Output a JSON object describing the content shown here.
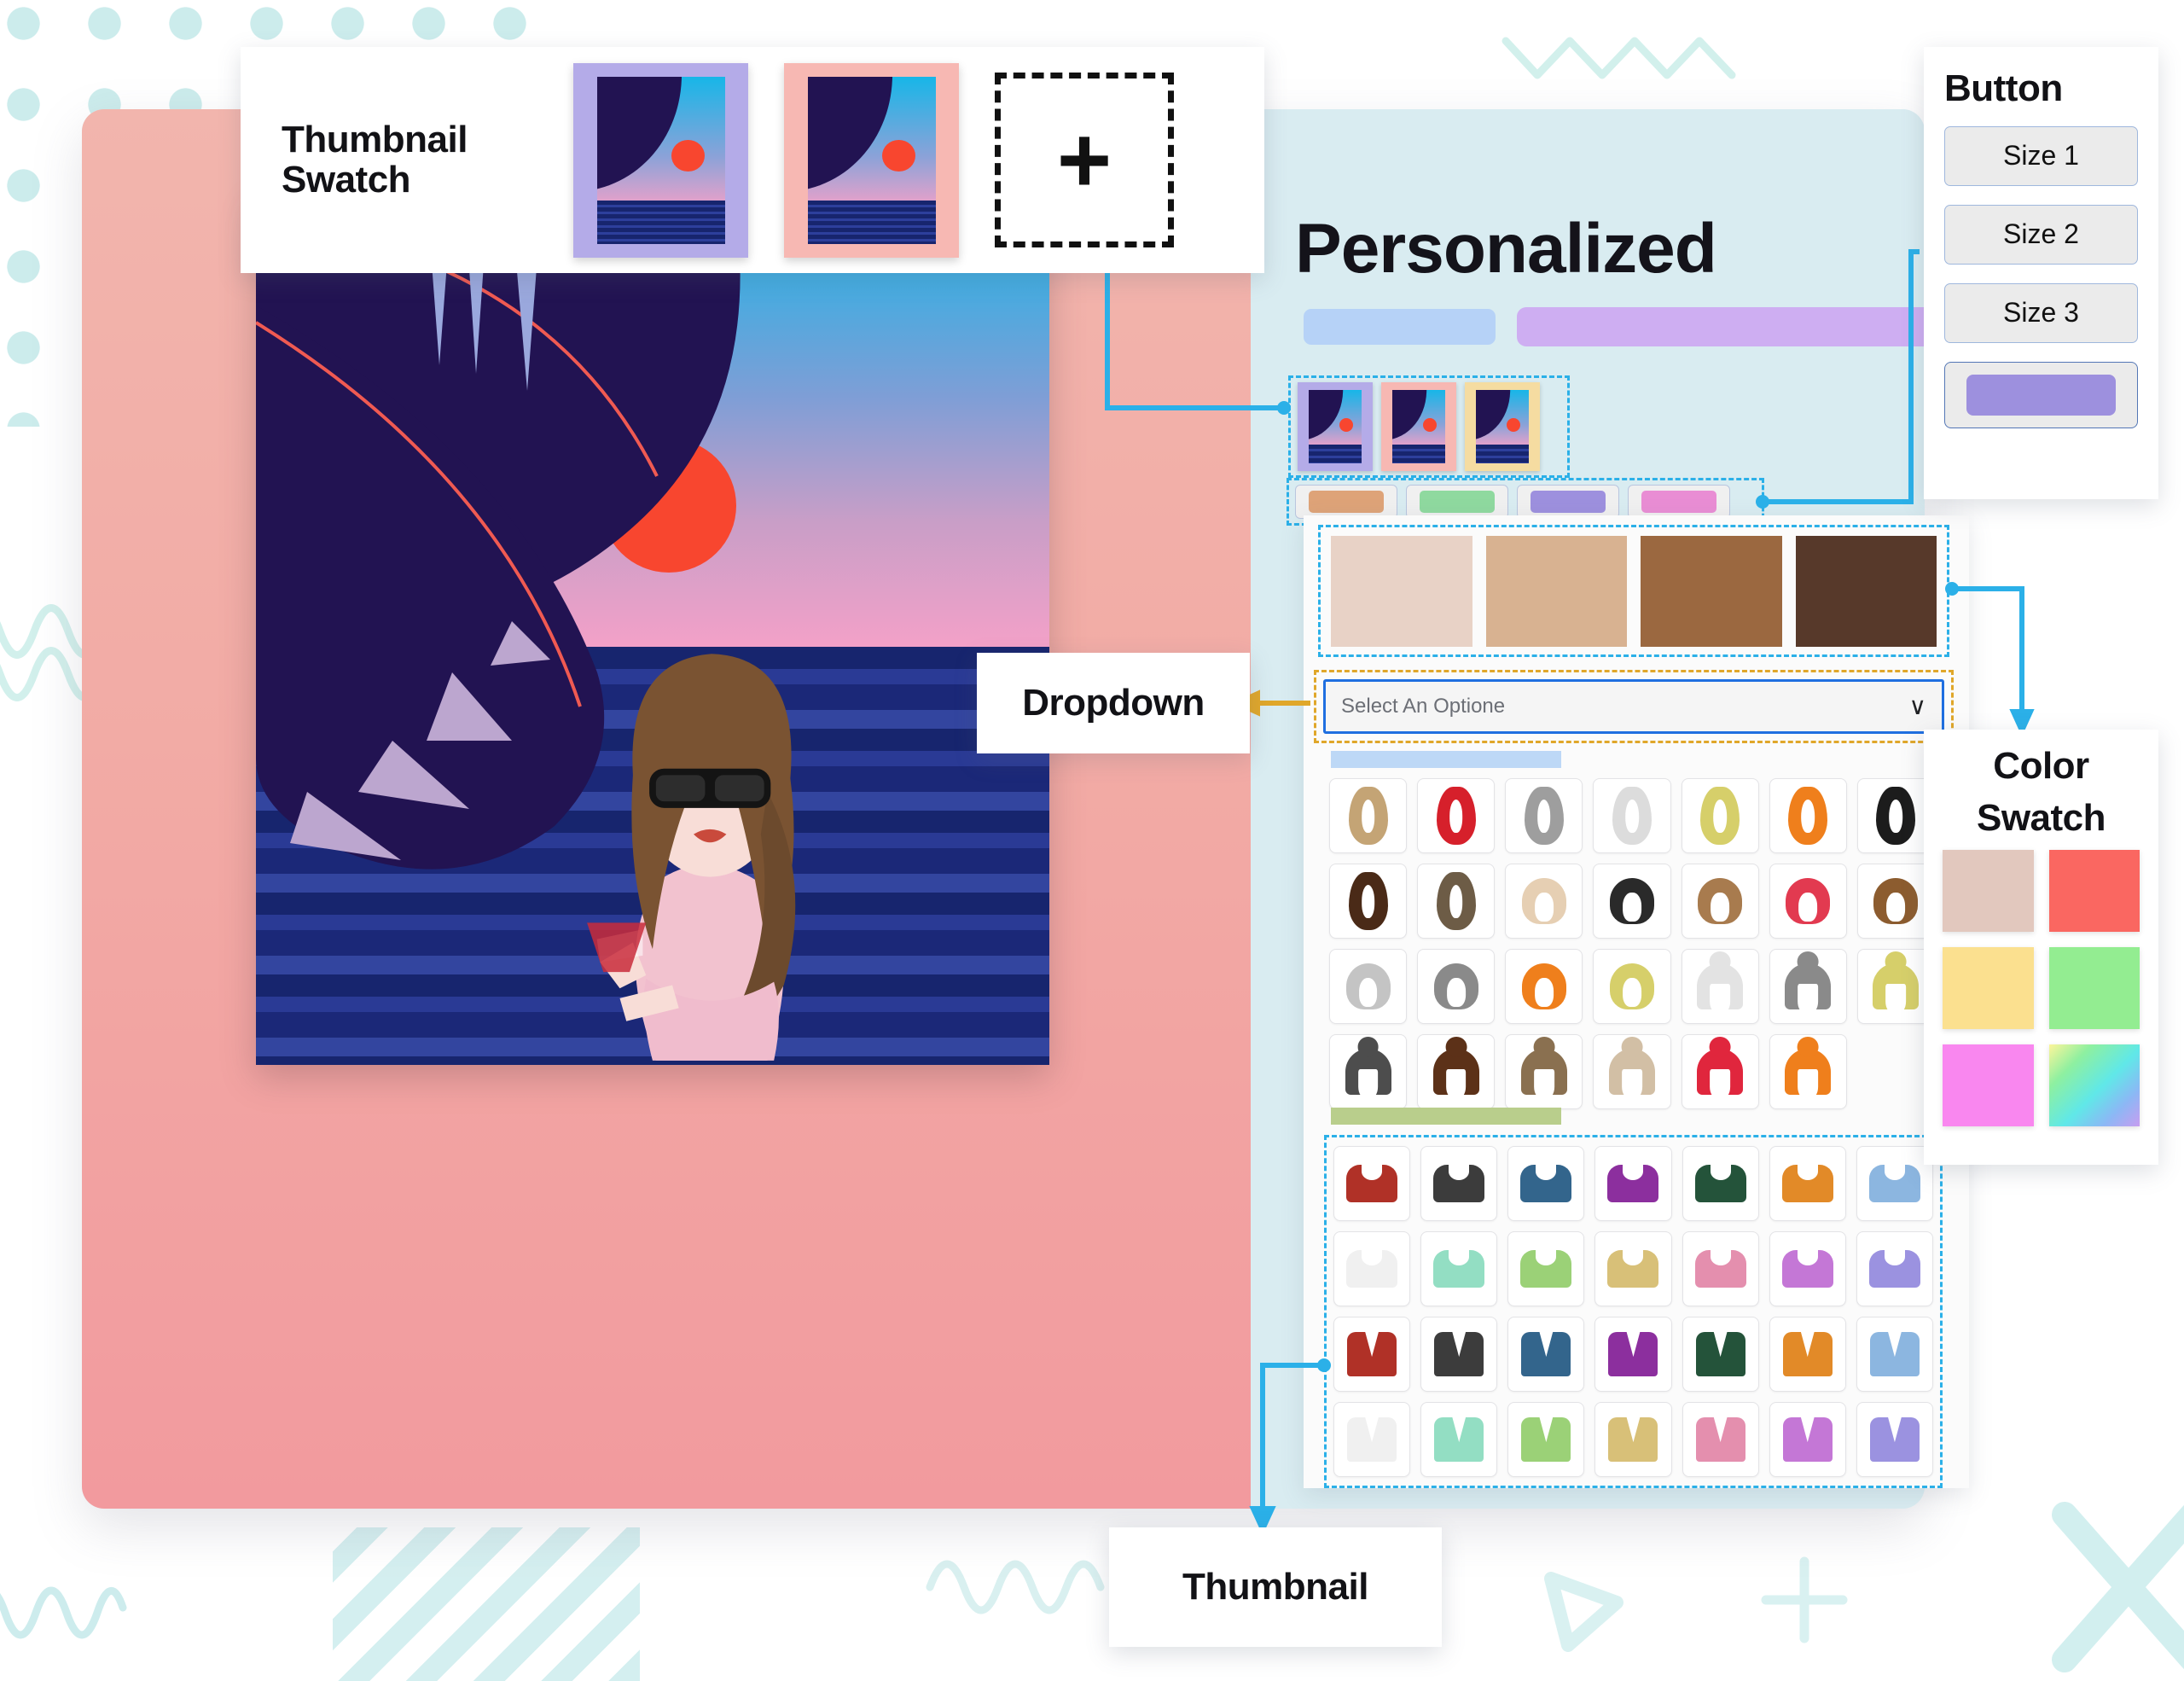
{
  "page": {
    "title": "Personalized",
    "accent_blue": "#2bb0e8",
    "accent_gold": "#e0a72a",
    "card_left_bg": "#f2aba5",
    "card_right_bg": "#d9ecf1"
  },
  "callouts": {
    "thumbnail_swatch": {
      "label_line1": "Thumbnail",
      "label_line2": "Swatch",
      "add_icon": "+"
    },
    "button": {
      "title": "Button",
      "items": [
        {
          "label": "Size 1"
        },
        {
          "label": "Size 2"
        },
        {
          "label": "Size 3"
        }
      ],
      "fill_button_color": "#9d90de"
    },
    "dropdown": {
      "title": "Dropdown"
    },
    "color_swatch": {
      "title_line1": "Color",
      "title_line2": "Swatch",
      "colors": [
        "#e2c8be",
        "#fa6761",
        "#fbe08f",
        "#93ed91",
        "#f987ef",
        "gradient"
      ]
    },
    "thumbnail": {
      "title": "Thumbnail"
    }
  },
  "controls": {
    "title": "Personalized",
    "bar_blue_color": "#b6d2f7",
    "bar_purple_color": "#ceaef2",
    "thumbnail_swatches": [
      {
        "frame_color": "#b4abe8"
      },
      {
        "frame_color": "#f7b8b3"
      },
      {
        "frame_color": "#f5dca1"
      }
    ],
    "color_chips": [
      "#dea378",
      "#8fd99f",
      "#9d90de",
      "#e98dd4"
    ],
    "skin_tones": [
      "#e8d2c6",
      "#d8b291",
      "#9b6840",
      "#57392a"
    ],
    "dropdown": {
      "placeholder": "Select An Optione",
      "chevron": "∨"
    },
    "label_bar_hair_color": "#bdd8f6",
    "label_bar_cloth_color": "#b9ce8c",
    "hair_swatches": [
      {
        "style": "long",
        "color": "#c4a475"
      },
      {
        "style": "long",
        "color": "#d6202b"
      },
      {
        "style": "long",
        "color": "#9e9e9e"
      },
      {
        "style": "long",
        "color": "#dcdcdc"
      },
      {
        "style": "long",
        "color": "#d6cf6a"
      },
      {
        "style": "long",
        "color": "#ef7f1c"
      },
      {
        "style": "long",
        "color": "#1c1c1c"
      },
      {
        "style": "long",
        "color": "#4a2a17"
      },
      {
        "style": "long",
        "color": "#6d5c46"
      },
      {
        "style": "bob",
        "color": "#e6cfb3"
      },
      {
        "style": "bob",
        "color": "#2a2a2a"
      },
      {
        "style": "bob",
        "color": "#a87b4e"
      },
      {
        "style": "bob",
        "color": "#e23a50"
      },
      {
        "style": "bob",
        "color": "#8c5c2f"
      },
      {
        "style": "bob",
        "color": "#c4c4c4"
      },
      {
        "style": "bob",
        "color": "#8a8a8a"
      },
      {
        "style": "bob",
        "color": "#ef7f1c"
      },
      {
        "style": "bob",
        "color": "#d6cf6a"
      },
      {
        "style": "bun",
        "color": "#e3e3e3"
      },
      {
        "style": "bun",
        "color": "#8a8a8a"
      },
      {
        "style": "bun",
        "color": "#d6cf6a"
      },
      {
        "style": "bun",
        "color": "#4d4d4d"
      },
      {
        "style": "bun",
        "color": "#5c3118"
      },
      {
        "style": "bun",
        "color": "#8a7050"
      },
      {
        "style": "bun",
        "color": "#d2bfa5"
      },
      {
        "style": "bun",
        "color": "#e0263d"
      },
      {
        "style": "bun",
        "color": "#ef7f1c"
      }
    ],
    "cloth_swatches": [
      {
        "style": "tee",
        "color": "#b03127"
      },
      {
        "style": "tee",
        "color": "#3c3c3c"
      },
      {
        "style": "tee",
        "color": "#33658c"
      },
      {
        "style": "tee",
        "color": "#8c2f9e"
      },
      {
        "style": "tee",
        "color": "#24533a"
      },
      {
        "style": "tee",
        "color": "#e28a28"
      },
      {
        "style": "tee",
        "color": "#8cb6e0"
      },
      {
        "style": "tee",
        "color": "#f0f0f0"
      },
      {
        "style": "tee",
        "color": "#93dec3"
      },
      {
        "style": "tee",
        "color": "#9bd177"
      },
      {
        "style": "tee",
        "color": "#d8c078"
      },
      {
        "style": "tee",
        "color": "#e48fae"
      },
      {
        "style": "tee",
        "color": "#c477d6"
      },
      {
        "style": "tee",
        "color": "#9b92e0"
      },
      {
        "style": "shirt",
        "color": "#b03127"
      },
      {
        "style": "shirt",
        "color": "#3c3c3c"
      },
      {
        "style": "shirt",
        "color": "#33658c"
      },
      {
        "style": "shirt",
        "color": "#8c2f9e"
      },
      {
        "style": "shirt",
        "color": "#24533a"
      },
      {
        "style": "shirt",
        "color": "#e28a28"
      },
      {
        "style": "shirt",
        "color": "#8cb6e0"
      },
      {
        "style": "shirt",
        "color": "#f0f0f0"
      },
      {
        "style": "shirt",
        "color": "#93dec3"
      },
      {
        "style": "shirt",
        "color": "#9bd177"
      },
      {
        "style": "shirt",
        "color": "#d8c078"
      },
      {
        "style": "shirt",
        "color": "#e48fae"
      },
      {
        "style": "shirt",
        "color": "#c477d6"
      },
      {
        "style": "shirt",
        "color": "#9b92e0"
      }
    ]
  },
  "poster": {
    "sun_color": "#f8462f",
    "leaf_color": "#221352"
  }
}
